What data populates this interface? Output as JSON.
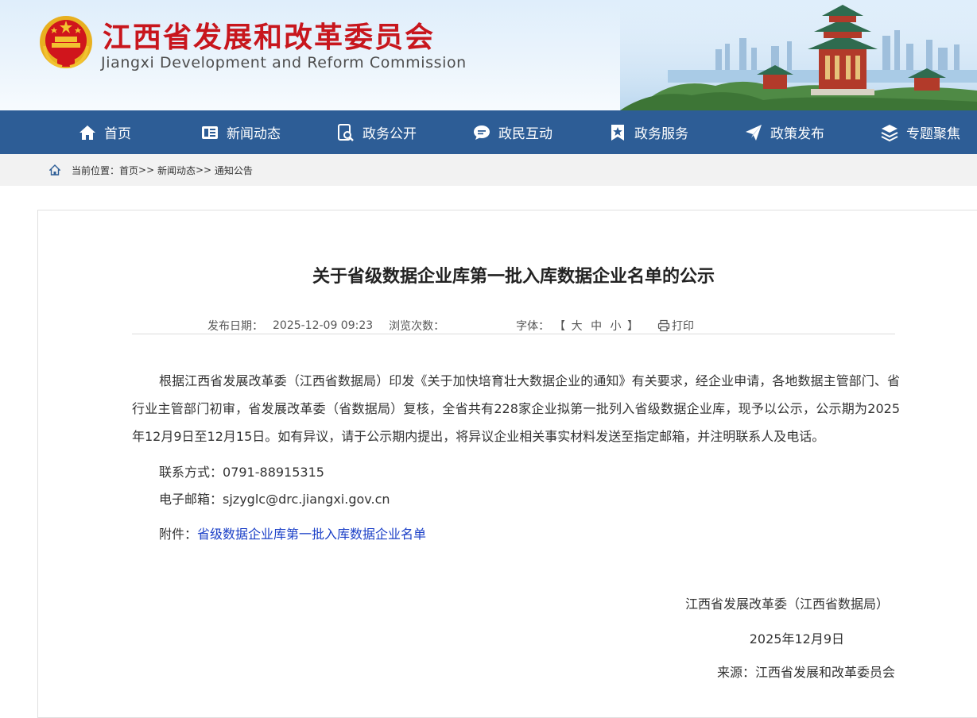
{
  "header": {
    "title": "江西省发展和改革委员会",
    "subtitle": "Jiangxi Development and Reform Commission"
  },
  "nav": {
    "items": [
      {
        "label": "首页",
        "icon": "home-icon"
      },
      {
        "label": "新闻动态",
        "icon": "news-icon"
      },
      {
        "label": "政务公开",
        "icon": "search-doc-icon"
      },
      {
        "label": "政民互动",
        "icon": "chat-icon"
      },
      {
        "label": "政务服务",
        "icon": "star-badge-icon"
      },
      {
        "label": "政策发布",
        "icon": "send-icon"
      },
      {
        "label": "专题聚焦",
        "icon": "layers-icon"
      }
    ]
  },
  "breadcrumb": {
    "prefix": "当前位置：",
    "items": [
      "首页",
      "新闻动态",
      "通知公告"
    ],
    "separator": ">>"
  },
  "article": {
    "title": "关于省级数据企业库第一批入库数据企业名单的公示",
    "meta": {
      "date_label": "发布日期：",
      "date_value": "2025-12-09 09:23",
      "views_label": "浏览次数：",
      "font_label": "字体：",
      "font_open": "【",
      "font_large": "大",
      "font_medium": "中",
      "font_small": "小",
      "font_close": "】",
      "print_label": "打印"
    },
    "body": "根据江西省发展改革委（江西省数据局）印发《关于加快培育壮大数据企业的通知》有关要求，经企业申请，各地数据主管部门、省行业主管部门初审，省发展改革委（省数据局）复核，全省共有228家企业拟第一批列入省级数据企业库，现予以公示，公示期为2025年12月9日至12月15日。如有异议，请于公示期内提出，将异议企业相关事实材料发送至指定邮箱，并注明联系人及电话。",
    "contact_label": "联系方式：",
    "contact_value": "0791-88915315",
    "email_label": "电子邮箱：",
    "email_value": "sjzyglc@drc.jiangxi.gov.cn",
    "attachment_label": "附件：",
    "attachment_link": "省级数据企业库第一批入库数据企业名单",
    "signature": "江西省发展改革委（江西省数据局）",
    "sign_date": "2025年12月9日",
    "source_label": "来源：",
    "source_value": "江西省发展和改革委员会"
  },
  "colors": {
    "brand_red": "#c8161d",
    "nav_blue": "#2d5d96",
    "link_blue": "#1a3fc7"
  }
}
